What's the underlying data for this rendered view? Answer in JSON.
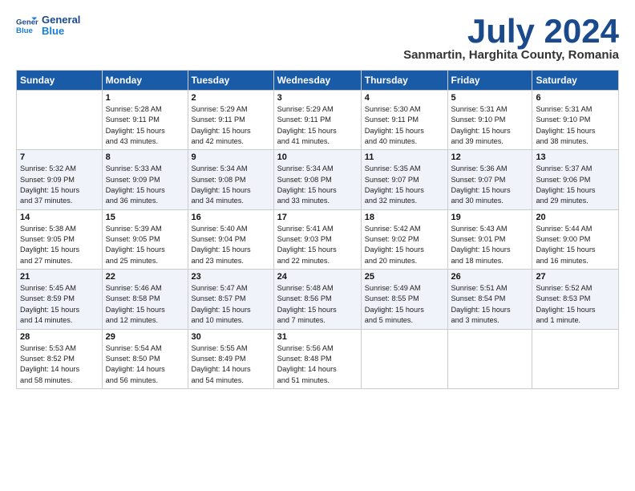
{
  "logo": {
    "line1": "General",
    "line2": "Blue"
  },
  "title": "July 2024",
  "subtitle": "Sanmartin, Harghita County, Romania",
  "header_days": [
    "Sunday",
    "Monday",
    "Tuesday",
    "Wednesday",
    "Thursday",
    "Friday",
    "Saturday"
  ],
  "weeks": [
    [
      {
        "day": "",
        "info": ""
      },
      {
        "day": "1",
        "info": "Sunrise: 5:28 AM\nSunset: 9:11 PM\nDaylight: 15 hours\nand 43 minutes."
      },
      {
        "day": "2",
        "info": "Sunrise: 5:29 AM\nSunset: 9:11 PM\nDaylight: 15 hours\nand 42 minutes."
      },
      {
        "day": "3",
        "info": "Sunrise: 5:29 AM\nSunset: 9:11 PM\nDaylight: 15 hours\nand 41 minutes."
      },
      {
        "day": "4",
        "info": "Sunrise: 5:30 AM\nSunset: 9:11 PM\nDaylight: 15 hours\nand 40 minutes."
      },
      {
        "day": "5",
        "info": "Sunrise: 5:31 AM\nSunset: 9:10 PM\nDaylight: 15 hours\nand 39 minutes."
      },
      {
        "day": "6",
        "info": "Sunrise: 5:31 AM\nSunset: 9:10 PM\nDaylight: 15 hours\nand 38 minutes."
      }
    ],
    [
      {
        "day": "7",
        "info": "Sunrise: 5:32 AM\nSunset: 9:09 PM\nDaylight: 15 hours\nand 37 minutes."
      },
      {
        "day": "8",
        "info": "Sunrise: 5:33 AM\nSunset: 9:09 PM\nDaylight: 15 hours\nand 36 minutes."
      },
      {
        "day": "9",
        "info": "Sunrise: 5:34 AM\nSunset: 9:08 PM\nDaylight: 15 hours\nand 34 minutes."
      },
      {
        "day": "10",
        "info": "Sunrise: 5:34 AM\nSunset: 9:08 PM\nDaylight: 15 hours\nand 33 minutes."
      },
      {
        "day": "11",
        "info": "Sunrise: 5:35 AM\nSunset: 9:07 PM\nDaylight: 15 hours\nand 32 minutes."
      },
      {
        "day": "12",
        "info": "Sunrise: 5:36 AM\nSunset: 9:07 PM\nDaylight: 15 hours\nand 30 minutes."
      },
      {
        "day": "13",
        "info": "Sunrise: 5:37 AM\nSunset: 9:06 PM\nDaylight: 15 hours\nand 29 minutes."
      }
    ],
    [
      {
        "day": "14",
        "info": "Sunrise: 5:38 AM\nSunset: 9:05 PM\nDaylight: 15 hours\nand 27 minutes."
      },
      {
        "day": "15",
        "info": "Sunrise: 5:39 AM\nSunset: 9:05 PM\nDaylight: 15 hours\nand 25 minutes."
      },
      {
        "day": "16",
        "info": "Sunrise: 5:40 AM\nSunset: 9:04 PM\nDaylight: 15 hours\nand 23 minutes."
      },
      {
        "day": "17",
        "info": "Sunrise: 5:41 AM\nSunset: 9:03 PM\nDaylight: 15 hours\nand 22 minutes."
      },
      {
        "day": "18",
        "info": "Sunrise: 5:42 AM\nSunset: 9:02 PM\nDaylight: 15 hours\nand 20 minutes."
      },
      {
        "day": "19",
        "info": "Sunrise: 5:43 AM\nSunset: 9:01 PM\nDaylight: 15 hours\nand 18 minutes."
      },
      {
        "day": "20",
        "info": "Sunrise: 5:44 AM\nSunset: 9:00 PM\nDaylight: 15 hours\nand 16 minutes."
      }
    ],
    [
      {
        "day": "21",
        "info": "Sunrise: 5:45 AM\nSunset: 8:59 PM\nDaylight: 15 hours\nand 14 minutes."
      },
      {
        "day": "22",
        "info": "Sunrise: 5:46 AM\nSunset: 8:58 PM\nDaylight: 15 hours\nand 12 minutes."
      },
      {
        "day": "23",
        "info": "Sunrise: 5:47 AM\nSunset: 8:57 PM\nDaylight: 15 hours\nand 10 minutes."
      },
      {
        "day": "24",
        "info": "Sunrise: 5:48 AM\nSunset: 8:56 PM\nDaylight: 15 hours\nand 7 minutes."
      },
      {
        "day": "25",
        "info": "Sunrise: 5:49 AM\nSunset: 8:55 PM\nDaylight: 15 hours\nand 5 minutes."
      },
      {
        "day": "26",
        "info": "Sunrise: 5:51 AM\nSunset: 8:54 PM\nDaylight: 15 hours\nand 3 minutes."
      },
      {
        "day": "27",
        "info": "Sunrise: 5:52 AM\nSunset: 8:53 PM\nDaylight: 15 hours\nand 1 minute."
      }
    ],
    [
      {
        "day": "28",
        "info": "Sunrise: 5:53 AM\nSunset: 8:52 PM\nDaylight: 14 hours\nand 58 minutes."
      },
      {
        "day": "29",
        "info": "Sunrise: 5:54 AM\nSunset: 8:50 PM\nDaylight: 14 hours\nand 56 minutes."
      },
      {
        "day": "30",
        "info": "Sunrise: 5:55 AM\nSunset: 8:49 PM\nDaylight: 14 hours\nand 54 minutes."
      },
      {
        "day": "31",
        "info": "Sunrise: 5:56 AM\nSunset: 8:48 PM\nDaylight: 14 hours\nand 51 minutes."
      },
      {
        "day": "",
        "info": ""
      },
      {
        "day": "",
        "info": ""
      },
      {
        "day": "",
        "info": ""
      }
    ]
  ]
}
